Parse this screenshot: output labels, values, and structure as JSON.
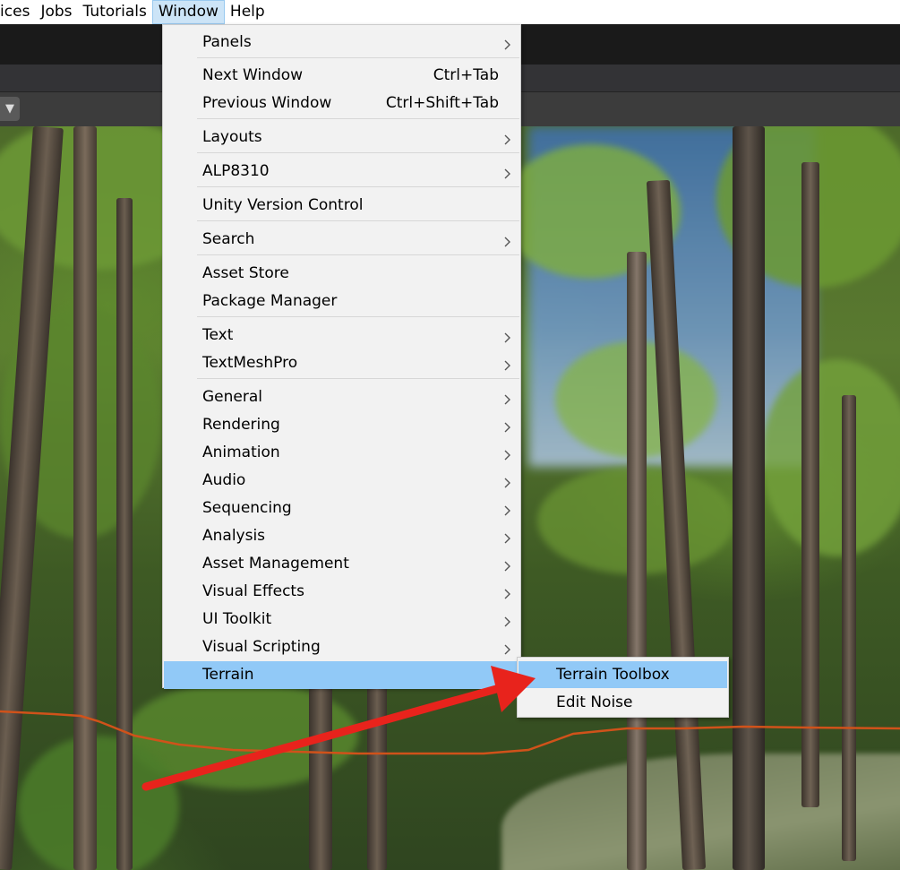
{
  "menubar": {
    "items": [
      "vices",
      "Jobs",
      "Tutorials",
      "Window",
      "Help"
    ],
    "active": "Window"
  },
  "scene": {
    "toolbar_dropdown_icon": "triangle-down-icon"
  },
  "window_menu": {
    "items": [
      {
        "label": "Panels",
        "submenu": true
      },
      {
        "label": "Next Window",
        "shortcut": "Ctrl+Tab"
      },
      {
        "label": "Previous Window",
        "shortcut": "Ctrl+Shift+Tab"
      },
      {
        "label": "Layouts",
        "submenu": true
      },
      {
        "label": "ALP8310",
        "submenu": true
      },
      {
        "label": "Unity Version Control"
      },
      {
        "label": "Search",
        "submenu": true
      },
      {
        "label": "Asset Store"
      },
      {
        "label": "Package Manager"
      },
      {
        "label": "Text",
        "submenu": true
      },
      {
        "label": "TextMeshPro",
        "submenu": true
      },
      {
        "label": "General",
        "submenu": true
      },
      {
        "label": "Rendering",
        "submenu": true
      },
      {
        "label": "Animation",
        "submenu": true
      },
      {
        "label": "Audio",
        "submenu": true
      },
      {
        "label": "Sequencing",
        "submenu": true
      },
      {
        "label": "Analysis",
        "submenu": true
      },
      {
        "label": "Asset Management",
        "submenu": true
      },
      {
        "label": "Visual Effects",
        "submenu": true
      },
      {
        "label": "UI Toolkit",
        "submenu": true
      },
      {
        "label": "Visual Scripting",
        "submenu": true
      },
      {
        "label": "Terrain",
        "submenu": true,
        "highlighted": true
      }
    ]
  },
  "terrain_submenu": {
    "items": [
      {
        "label": "Terrain Toolbox",
        "highlighted": true
      },
      {
        "label": "Edit Noise"
      }
    ]
  },
  "annotation": {
    "arrow_color": "#e8231c",
    "arrow_icon": "red-arrow-annotation"
  },
  "colors": {
    "highlight": "#91c9f7",
    "menu_bg": "#f2f2f2",
    "menubar_active": "#cce4f7",
    "terrain_line": "#d0521a"
  }
}
